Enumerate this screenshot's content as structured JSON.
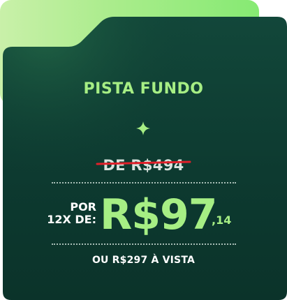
{
  "colors": {
    "accent_green": "#a6ee84",
    "card_dark": "#0d3a30",
    "strike_red": "#e0202a",
    "tab_light": "#c9f0a9"
  },
  "plan": {
    "name": "PISTA FUNDO",
    "spark_icon": "sparkle-icon",
    "old_price": "DE R$494",
    "installment_prefix_line1": "POR",
    "installment_prefix_line2": "12X DE:",
    "installment_value": "R$97",
    "installment_cents": ",14",
    "cash_price": "OU R$297 À VISTA"
  }
}
